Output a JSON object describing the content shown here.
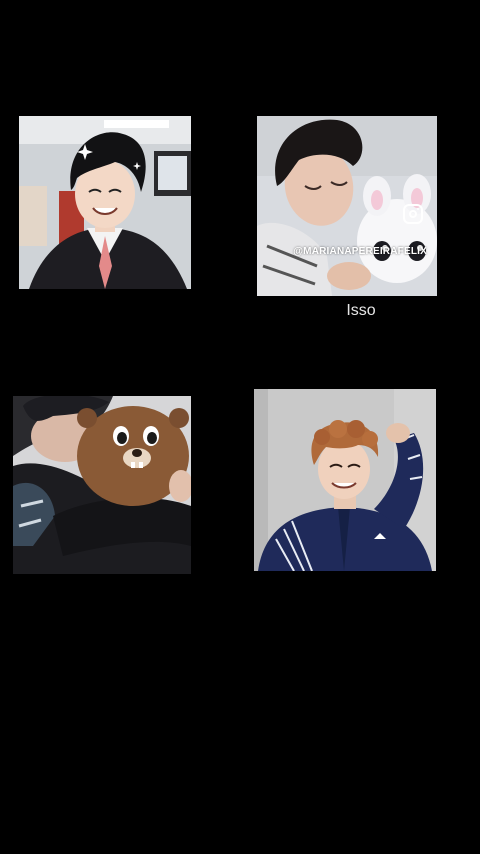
{
  "photos": [
    {
      "name": "photo-top-left"
    },
    {
      "name": "photo-top-right",
      "watermark": "@MARIANAPEREIRAFELIX"
    },
    {
      "name": "photo-bottom-left"
    },
    {
      "name": "photo-bottom-right"
    }
  ],
  "caption": "Isso",
  "icons": {
    "instagram": "instagram-icon"
  }
}
